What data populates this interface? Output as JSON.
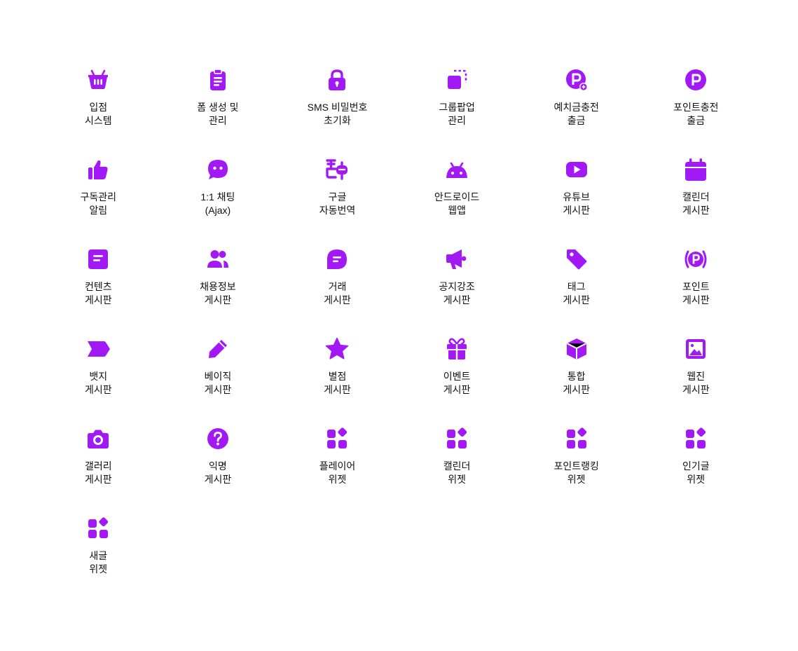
{
  "accent_color": "#A219F5",
  "tiles": [
    {
      "icon": "basket-icon",
      "line1": "입점",
      "line2": "시스템"
    },
    {
      "icon": "clipboard-icon",
      "line1": "폼 생성 및",
      "line2": "관리"
    },
    {
      "icon": "lock-icon",
      "line1": "SMS 비밀번호",
      "line2": "초기화"
    },
    {
      "icon": "popup-icon",
      "line1": "그룹팝업",
      "line2": "관리"
    },
    {
      "icon": "point-plus-icon",
      "line1": "예치금충전",
      "line2": "출금"
    },
    {
      "icon": "point-icon",
      "line1": "포인트충전",
      "line2": "출금"
    },
    {
      "icon": "thumbs-up-icon",
      "line1": "구독관리",
      "line2": "알림"
    },
    {
      "icon": "chat-bubble-icon",
      "line1": "1:1 채팅",
      "line2": "(Ajax)"
    },
    {
      "icon": "translate-icon",
      "line1": "구글",
      "line2": "자동번역"
    },
    {
      "icon": "android-icon",
      "line1": "안드로이드",
      "line2": "웹앱"
    },
    {
      "icon": "youtube-icon",
      "line1": "유튜브",
      "line2": "게시판"
    },
    {
      "icon": "calendar-icon",
      "line1": "캘린더",
      "line2": "게시판"
    },
    {
      "icon": "content-icon",
      "line1": "컨텐츠",
      "line2": "게시판"
    },
    {
      "icon": "users-icon",
      "line1": "채용정보",
      "line2": "게시판"
    },
    {
      "icon": "message-icon",
      "line1": "거래",
      "line2": "게시판"
    },
    {
      "icon": "megaphone-icon",
      "line1": "공지강조",
      "line2": "게시판"
    },
    {
      "icon": "tag-icon",
      "line1": "태그",
      "line2": "게시판"
    },
    {
      "icon": "point-broadcast-icon",
      "line1": "포인트",
      "line2": "게시판"
    },
    {
      "icon": "badge-icon",
      "line1": "뱃지",
      "line2": "게시판"
    },
    {
      "icon": "pencil-icon",
      "line1": "베이직",
      "line2": "게시판"
    },
    {
      "icon": "star-icon",
      "line1": "별점",
      "line2": "게시판"
    },
    {
      "icon": "gift-icon",
      "line1": "이벤트",
      "line2": "게시판"
    },
    {
      "icon": "cube-icon",
      "line1": "통합",
      "line2": "게시판"
    },
    {
      "icon": "image-icon",
      "line1": "웹진",
      "line2": "게시판"
    },
    {
      "icon": "camera-icon",
      "line1": "갤러리",
      "line2": "게시판"
    },
    {
      "icon": "question-icon",
      "line1": "익명",
      "line2": "게시판"
    },
    {
      "icon": "widget-icon",
      "line1": "플레이어",
      "line2": "위젯"
    },
    {
      "icon": "widget-icon",
      "line1": "캘린더",
      "line2": "위젯"
    },
    {
      "icon": "widget-icon",
      "line1": "포인트랭킹",
      "line2": "위젯"
    },
    {
      "icon": "widget-icon",
      "line1": "인기글",
      "line2": "위젯"
    },
    {
      "icon": "widget-icon",
      "line1": "새글",
      "line2": "위젯"
    }
  ]
}
